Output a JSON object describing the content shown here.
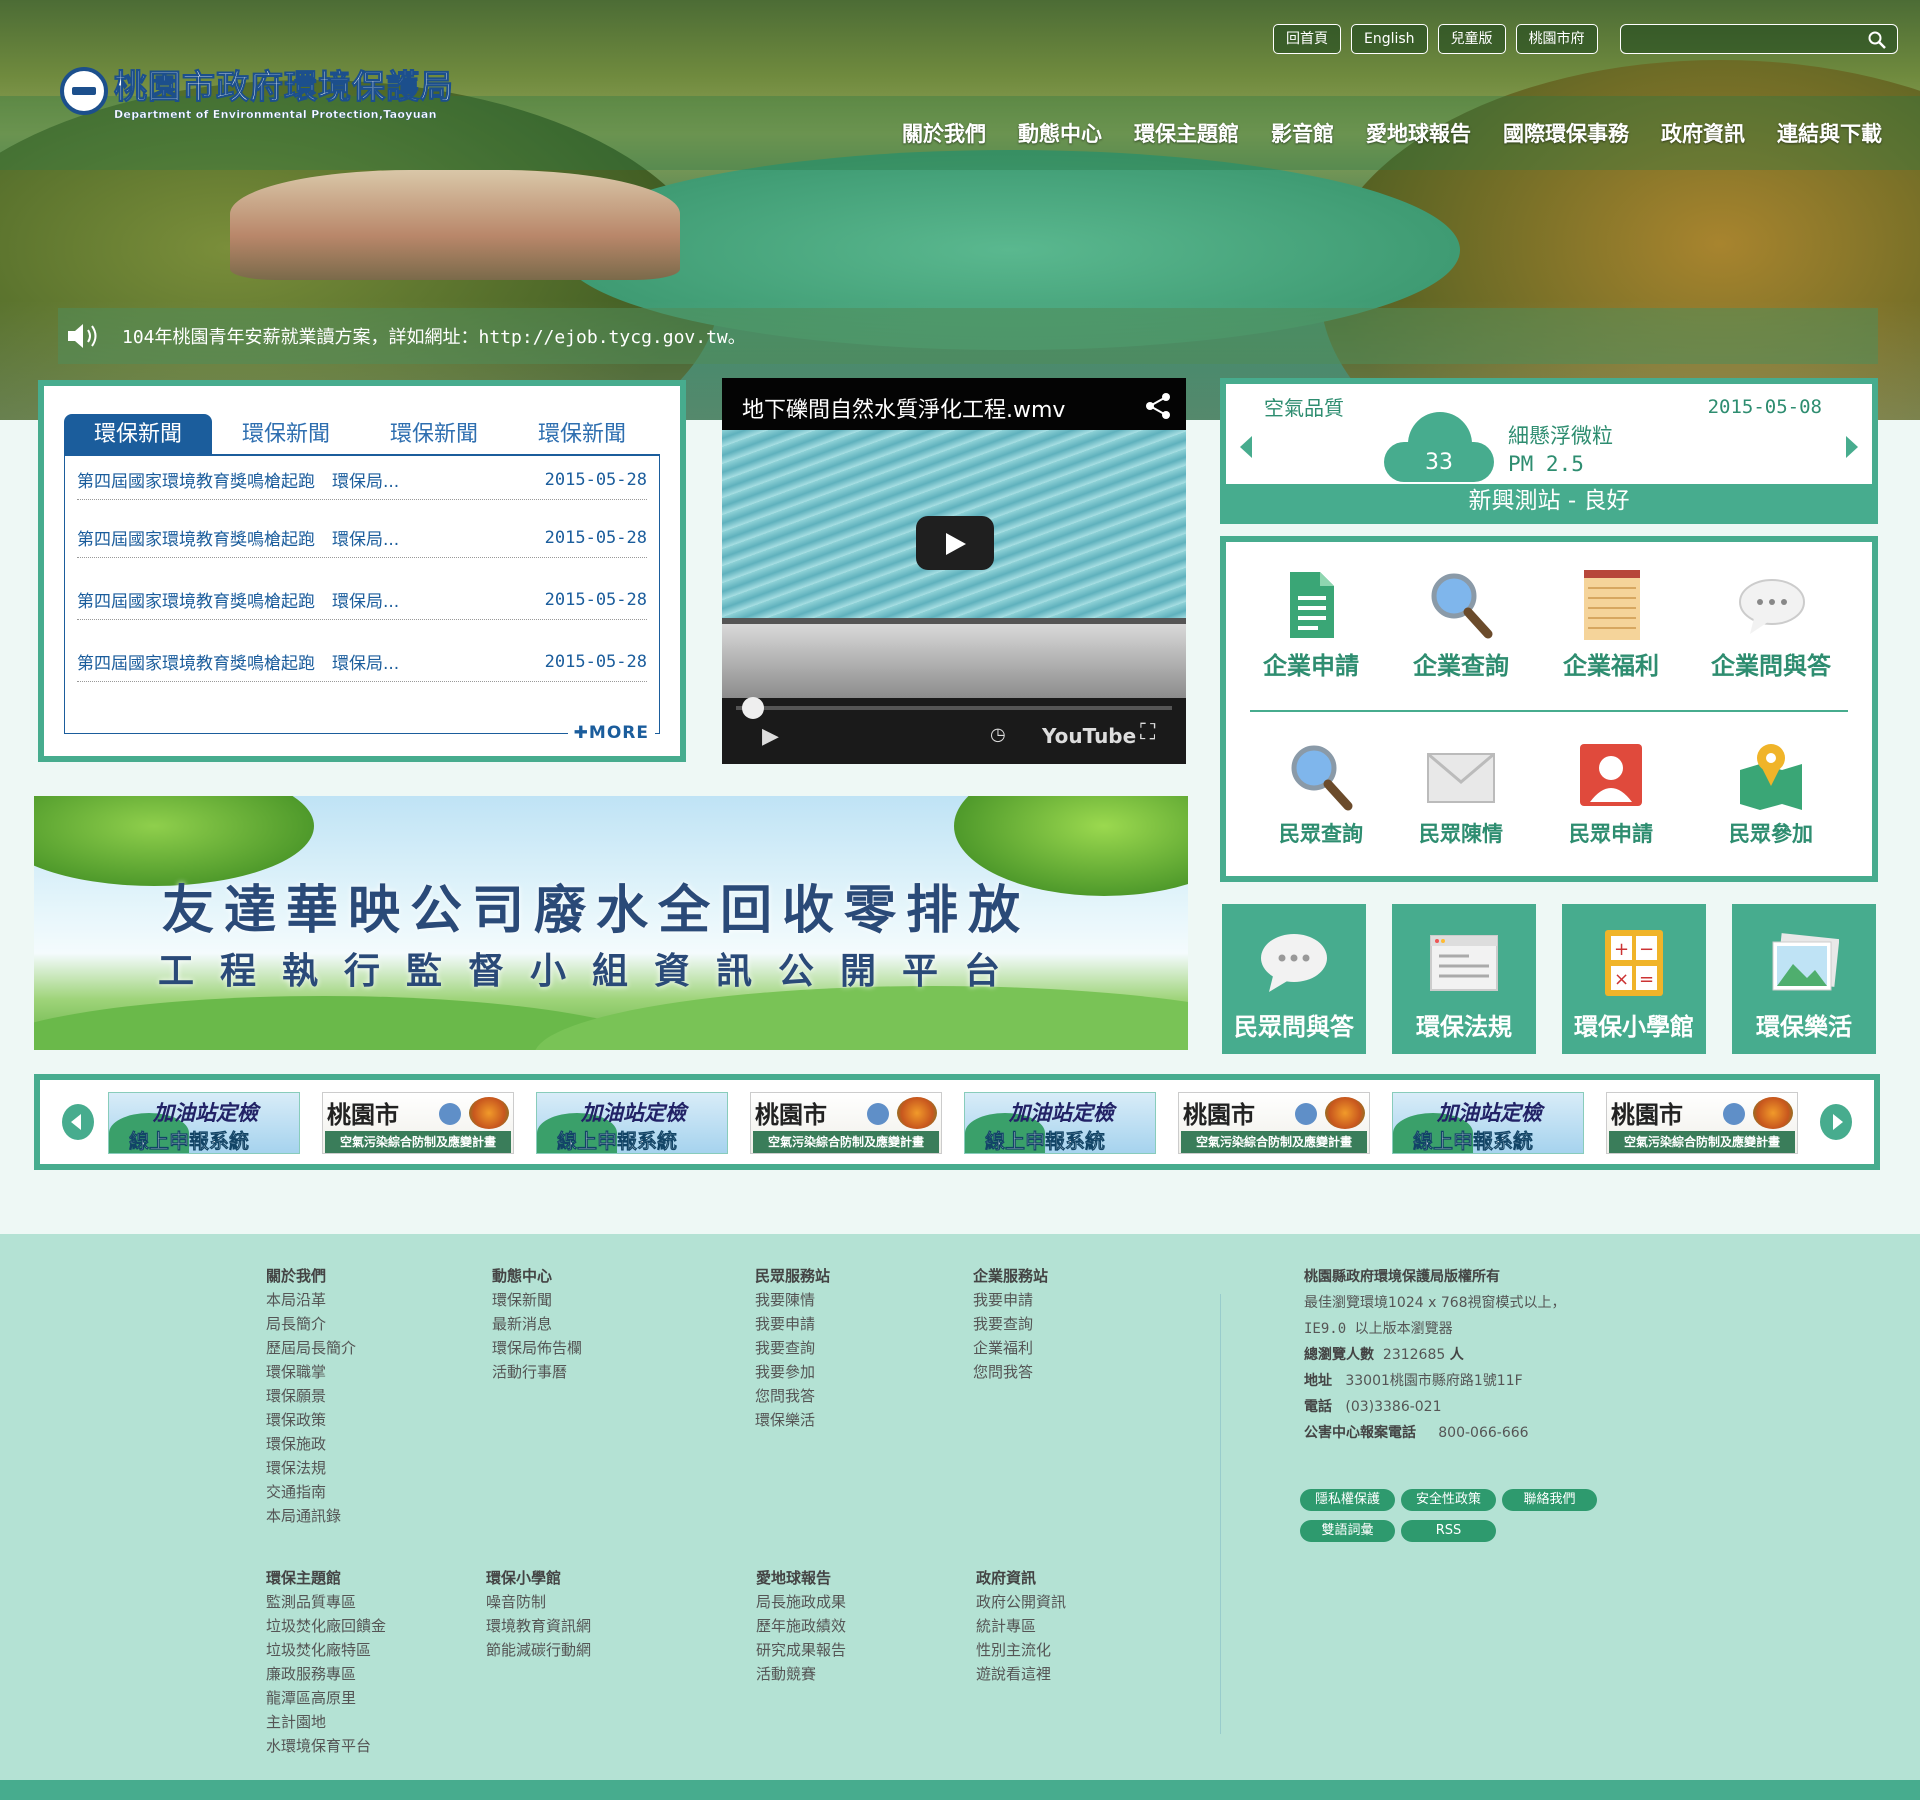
{
  "header": {
    "logo_cn": "桃園市政府環境保護局",
    "logo_en": "Department of Environmental Protection,Taoyuan",
    "top_links": [
      "回首頁",
      "English",
      "兒童版",
      "桃園市府"
    ],
    "search_placeholder": "",
    "nav": [
      "關於我們",
      "動態中心",
      "環保主題館",
      "影音館",
      "愛地球報告",
      "國際環保事務",
      "政府資訊",
      "連結與下載"
    ]
  },
  "marquee": {
    "text": "104年桃園青年安薪就業讀方案，詳如網址：http://ejob.tycg.gov.tw。"
  },
  "news": {
    "tabs": [
      "環保新聞",
      "環保新聞",
      "環保新聞",
      "環保新聞"
    ],
    "items": [
      {
        "title": "第四屆國家環境教育獎鳴槍起跑　環保局...",
        "date": "2015-05-28"
      },
      {
        "title": "第四屆國家環境教育獎鳴槍起跑　環保局...",
        "date": "2015-05-28"
      },
      {
        "title": "第四屆國家環境教育獎鳴槍起跑　環保局...",
        "date": "2015-05-28"
      },
      {
        "title": "第四屆國家環境教育獎鳴槍起跑　環保局...",
        "date": "2015-05-28"
      }
    ],
    "more": "MORE"
  },
  "video": {
    "title": "地下礫間自然水質淨化工程.wmv",
    "brand": "YouTube"
  },
  "air": {
    "label": "空氣品質",
    "date": "2015-05-08",
    "value": "33",
    "pollutant": "細懸浮微粒",
    "pm": "PM 2.5",
    "station": "新興測站 - 良好"
  },
  "services": [
    {
      "label": "企業申請",
      "icon": "document-icon"
    },
    {
      "label": "企業查詢",
      "icon": "magnifier-icon"
    },
    {
      "label": "企業福利",
      "icon": "notepad-icon"
    },
    {
      "label": "企業問與答",
      "icon": "chat-bubble-icon"
    },
    {
      "label": "民眾查詢",
      "icon": "magnifier-icon"
    },
    {
      "label": "民眾陳情",
      "icon": "envelope-icon"
    },
    {
      "label": "民眾申請",
      "icon": "person-icon"
    },
    {
      "label": "民眾參加",
      "icon": "map-pin-icon"
    }
  ],
  "banner": {
    "line1": "友達華映公司廢水全回收零排放",
    "line2": "工程執行監督小組資訊公開平台"
  },
  "tiles": [
    {
      "label": "民眾問與答",
      "icon": "chat-bubble-icon"
    },
    {
      "label": "環保法規",
      "icon": "browser-icon"
    },
    {
      "label": "環保小學館",
      "icon": "calculator-icon"
    },
    {
      "label": "環保樂活",
      "icon": "photo-icon"
    }
  ],
  "slider": {
    "gas": {
      "line1": "加油站定檢",
      "line2": "線上申報系統"
    },
    "ty": {
      "line1": "桃園市",
      "line2": "空氣污染綜合防制及應變計畫"
    }
  },
  "footer": {
    "col1": {
      "title": "關於我們",
      "items": [
        "本局沿革",
        "局長簡介",
        "歷屆局長簡介",
        "環保職掌",
        "環保願景",
        "環保政策",
        "環保施政",
        "環保法規",
        "交通指南",
        "本局通訊錄"
      ]
    },
    "col2": {
      "title": "動態中心",
      "items": [
        "環保新聞",
        "最新消息",
        "環保局佈告欄",
        "活動行事曆"
      ]
    },
    "col3": {
      "title": "民眾服務站",
      "items": [
        "我要陳情",
        "我要申請",
        "我要查詢",
        "我要參加",
        "您問我答",
        "環保樂活"
      ]
    },
    "col4": {
      "title": "企業服務站",
      "items": [
        "我要申請",
        "我要查詢",
        "企業福利",
        "您問我答"
      ]
    },
    "col5": {
      "title": "環保主題館",
      "items": [
        "監測品質專區",
        "垃圾焚化廠回饋金",
        "垃圾焚化廠特區",
        "廉政服務專區",
        "龍潭區高原里",
        "主計園地",
        "水環境保育平台"
      ]
    },
    "col6": {
      "title": "環保小學館",
      "items": [
        "噪音防制",
        "環境教育資訊網",
        "節能減碳行動網"
      ]
    },
    "col7": {
      "title": "愛地球報告",
      "items": [
        "局長施政成果",
        "歷年施政績效",
        "研究成果報告",
        "活動競賽"
      ]
    },
    "col8": {
      "title": "政府資訊",
      "items": [
        "政府公開資訊",
        "統計專區",
        "性別主流化",
        "遊說看這裡"
      ]
    },
    "info": {
      "copyright": "桃園縣政府環境保護局版權所有",
      "browse1": "最佳瀏覽環境1024 x 768視窗模式以上，",
      "browse2": "IE9.0 以上版本瀏覽器",
      "visits_label": "總瀏覽人數",
      "visits": "2312685",
      "visits_unit": "人",
      "addr_label": "地址",
      "addr": "33001桃園市縣府路1號11F",
      "tel_label": "電話",
      "tel": "(03)3386-021",
      "hotline_label": "公害中心報案電話",
      "hotline": "800-066-666"
    },
    "pills": [
      "隱私權保護",
      "安全性政策",
      "聯絡我們",
      "雙語詞彙",
      "RSS"
    ]
  }
}
